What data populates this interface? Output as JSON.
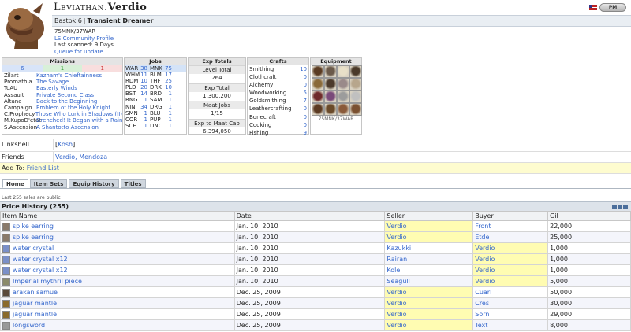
{
  "character": {
    "server": "Leviathan.",
    "name": "Verdio",
    "nation_rank": "Bastok 6",
    "title": "Transient Dreamer",
    "job_line": "75MNK/37WAR",
    "community_profile": "LS Community Profile",
    "last_scanned": "Last scanned: 9 Days",
    "queue_update": "Queue for update",
    "pm_label": "PM"
  },
  "missions": {
    "heading": "Missions",
    "counts": [
      "6",
      "1",
      "1"
    ],
    "rows": [
      {
        "key": "Zilart",
        "value": "Kazham's Chieftainness"
      },
      {
        "key": "Promathia",
        "value": "The Savage"
      },
      {
        "key": "ToAU",
        "value": "Easterly Winds"
      },
      {
        "key": "Assault",
        "value": "Private Second Class"
      },
      {
        "key": "Altana",
        "value": "Back to the Beginning"
      },
      {
        "key": "Campaign",
        "value": "Emblem of the Holy Knight"
      },
      {
        "key": "C.Prophecy",
        "value": "Those Who Lurk in Shadows (II)"
      },
      {
        "key": "M.KupoD'etat",
        "value": "Drenched! It Began with a Raindrop"
      },
      {
        "key": "S.Ascension",
        "value": "A Shantotto Ascension"
      }
    ]
  },
  "jobs": {
    "heading": "Jobs",
    "rows": [
      {
        "l": "WAR",
        "ln": "38",
        "r": "MNK",
        "rn": "75",
        "hl": true
      },
      {
        "l": "WHM",
        "ln": "11",
        "r": "BLM",
        "rn": "17"
      },
      {
        "l": "RDM",
        "ln": "10",
        "r": "THF",
        "rn": "25"
      },
      {
        "l": "PLD",
        "ln": "20",
        "r": "DRK",
        "rn": "10"
      },
      {
        "l": "BST",
        "ln": "14",
        "r": "BRD",
        "rn": "1"
      },
      {
        "l": "RNG",
        "ln": "1",
        "r": "SAM",
        "rn": "1"
      },
      {
        "l": "NIN",
        "ln": "34",
        "r": "DRG",
        "rn": "1"
      },
      {
        "l": "SMN",
        "ln": "1",
        "r": "BLU",
        "rn": "1"
      },
      {
        "l": "COR",
        "ln": "1",
        "r": "PUP",
        "rn": "1"
      },
      {
        "l": "SCH",
        "ln": "1",
        "r": "DNC",
        "rn": "1"
      }
    ]
  },
  "exp": {
    "heading": "Exp Totals",
    "level_total_label": "Level Total",
    "level_total": "264",
    "exp_total_label": "Exp Total",
    "exp_total": "1,300,200",
    "maat_label": "Maat Jobs",
    "maat": "1/15",
    "maat_cap_label": "Exp to Maat Cap",
    "maat_cap": "6,394,050"
  },
  "crafts": {
    "heading": "Crafts",
    "rows": [
      {
        "k": "Smithing",
        "v": "10"
      },
      {
        "k": "Clothcraft",
        "v": "0"
      },
      {
        "k": "Alchemy",
        "v": "0"
      },
      {
        "k": "Woodworking",
        "v": "5"
      },
      {
        "k": "Goldsmithing",
        "v": "7"
      },
      {
        "k": "Leathercrafting",
        "v": "0"
      },
      {
        "k": "Bonecraft",
        "v": "0"
      },
      {
        "k": "Cooking",
        "v": "0"
      },
      {
        "k": "Fishing",
        "v": "9"
      }
    ]
  },
  "equipment": {
    "heading": "Equipment",
    "caption": "75MNK/37WAR",
    "slot_colors": [
      "#5a3b22",
      "#6b5a4a",
      "#e8e0c8",
      "#4a3a2a",
      "#8a6a3a",
      "#4d3b2c",
      "#9a8a8a",
      "#b7a68c",
      "#6e2a2a",
      "#7a4a7a",
      "#9c9c9c",
      "#c0c0c0",
      "#5b3a22",
      "#6a4a2a",
      "#8a5a3a",
      "#7a5030"
    ]
  },
  "linkshell": {
    "label": "Linkshell",
    "name": "Kosh"
  },
  "friends": {
    "label": "Friends",
    "list": "Verdio, Mendoza"
  },
  "add_to": {
    "label": "Add To:",
    "link": "Friend List"
  },
  "tabs": [
    "Home",
    "Item Sets",
    "Equip History",
    "Titles"
  ],
  "sales_note": "Last 255 sales are public",
  "price_history": {
    "title": "Price History (255)",
    "columns": [
      "Item Name",
      "Date",
      "Seller",
      "Buyer",
      "Gil"
    ],
    "rows": [
      {
        "item": "spike earring",
        "date": "Jan. 10, 2010",
        "seller": "Verdio",
        "buyer": "Front",
        "gil": "22,000",
        "icon": "#8a7a6a"
      },
      {
        "item": "spike earring",
        "date": "Jan. 10, 2010",
        "seller": "Verdio",
        "buyer": "Etde",
        "gil": "25,000",
        "icon": "#8a7a6a"
      },
      {
        "item": "water crystal",
        "date": "Jan. 10, 2010",
        "seller": "Kazukki",
        "buyer": "Verdio",
        "gil": "1,000",
        "icon": "#7a8fc8"
      },
      {
        "item": "water crystal x12",
        "date": "Jan. 10, 2010",
        "seller": "Rairan",
        "buyer": "Verdio",
        "gil": "1,000",
        "icon": "#7a8fc8"
      },
      {
        "item": "water crystal x12",
        "date": "Jan. 10, 2010",
        "seller": "Kole",
        "buyer": "Verdio",
        "gil": "1,000",
        "icon": "#7a8fc8"
      },
      {
        "item": "Imperial mythril piece",
        "date": "Jan. 10, 2010",
        "seller": "Seagull",
        "buyer": "Verdio",
        "gil": "5,000",
        "icon": "#8a8a6a"
      },
      {
        "item": "arakan samue",
        "date": "Dec. 25, 2009",
        "seller": "Verdio",
        "buyer": "Cuarl",
        "gil": "50,000",
        "icon": "#5a4a3a"
      },
      {
        "item": "jaguar mantle",
        "date": "Dec. 25, 2009",
        "seller": "Verdio",
        "buyer": "Cres",
        "gil": "30,000",
        "icon": "#8a6a2a"
      },
      {
        "item": "jaguar mantle",
        "date": "Dec. 25, 2009",
        "seller": "Verdio",
        "buyer": "Sorn",
        "gil": "29,000",
        "icon": "#8a6a2a"
      },
      {
        "item": "longsword",
        "date": "Dec. 25, 2009",
        "seller": "Verdio",
        "buyer": "Text",
        "gil": "8,000",
        "icon": "#9a9a9a"
      }
    ]
  }
}
